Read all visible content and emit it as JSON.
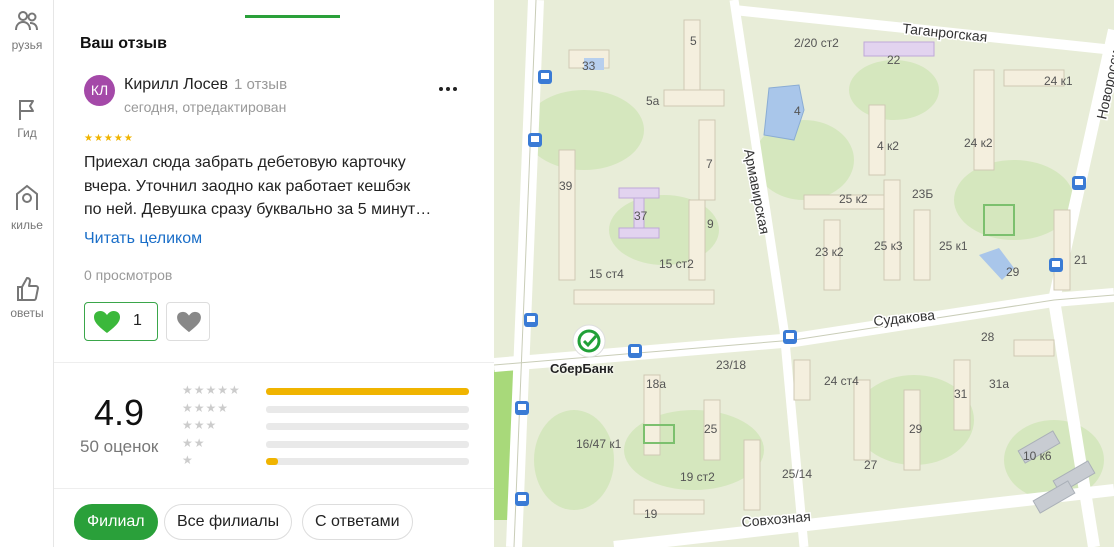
{
  "rail": {
    "items": [
      {
        "label": "рузья",
        "icon": "friends-icon"
      },
      {
        "label": "Гид",
        "icon": "flag-icon"
      },
      {
        "label": "килье",
        "icon": "house-icon"
      },
      {
        "label": "оветы",
        "icon": "thumb-up-icon"
      }
    ]
  },
  "panel": {
    "section_title": "Ваш отзыв",
    "review": {
      "avatar_initials": "КЛ",
      "avatar_color": "#a449a8",
      "author": "Кирилл Лосев",
      "author_review_count": "1 отзыв",
      "date": "сегодня, отредактирован",
      "rating_stars": 5,
      "text_lines": [
        "Приехал сюда забрать дебетовую карточку",
        "вчера. Уточнил заодно как работает кешбэк",
        "по ней. Девушка сразу буквально за 5 минут…"
      ],
      "read_more": "Читать целиком",
      "views": "0 просмотров",
      "likes": "1"
    },
    "summary": {
      "rating": "4.9",
      "count_label": "50 оценок",
      "distribution": [
        {
          "stars": 5,
          "fraction": 1.0
        },
        {
          "stars": 4,
          "fraction": 0.0
        },
        {
          "stars": 3,
          "fraction": 0.0
        },
        {
          "stars": 2,
          "fraction": 0.0
        },
        {
          "stars": 1,
          "fraction": 0.06
        }
      ]
    },
    "filters": [
      {
        "label": "Филиал",
        "active": true
      },
      {
        "label": "Все филиалы",
        "active": false
      },
      {
        "label": "С ответами",
        "active": false
      }
    ]
  },
  "map": {
    "streets": [
      "Таганрогская",
      "Армавирская",
      "Судакова",
      "Совхозная",
      "Новоросси"
    ],
    "buildings": [
      "33",
      "5",
      "2/20 ст2",
      "22",
      "24 к1",
      "5а",
      "4",
      "4 к2",
      "24 к2",
      "7",
      "37",
      "39",
      "9",
      "23Б",
      "25 к2",
      "23 к2",
      "25 к3",
      "25 к1",
      "29",
      "21",
      "15 ст4",
      "15 ст2",
      "28",
      "23/18",
      "24 ст4",
      "18а",
      "31",
      "31а",
      "16/47 к1",
      "25",
      "29",
      "10 к6",
      "19 ст2",
      "25/14",
      "27",
      "19"
    ],
    "poi": {
      "name": "СберБанк",
      "icon": "sberbank-icon"
    }
  }
}
